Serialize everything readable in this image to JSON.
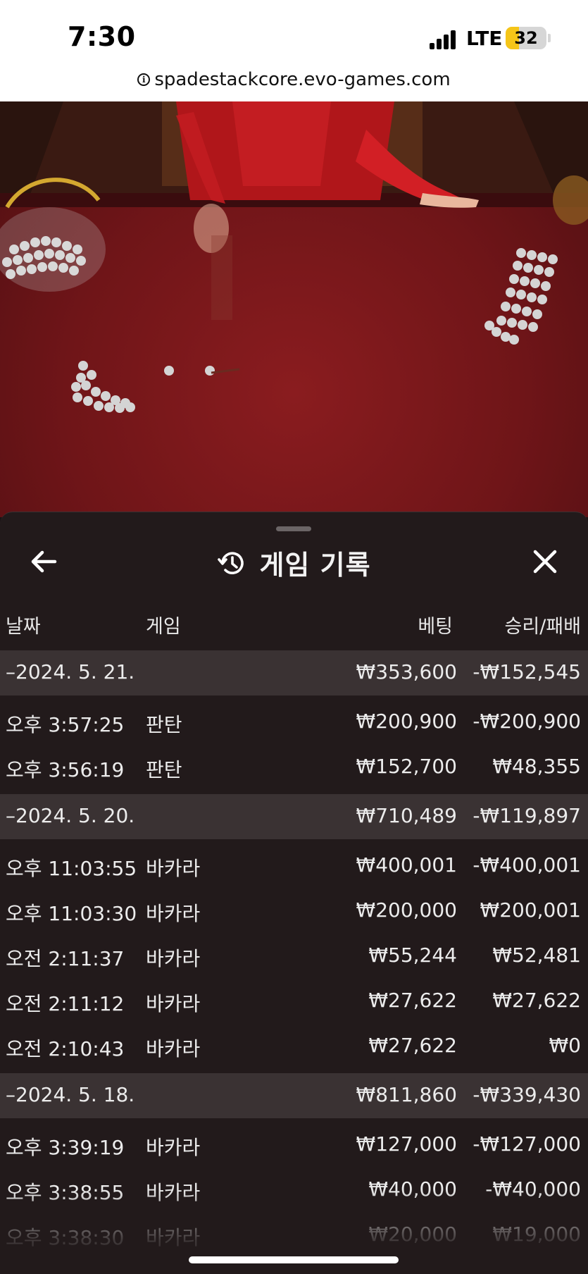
{
  "status_bar": {
    "time": "7:30",
    "network": "LTE",
    "battery": "32",
    "battery_level": 0.32
  },
  "url_bar": {
    "url": "spadestackcore.evo-games.com"
  },
  "panel": {
    "title": "게임 기록",
    "columns": {
      "date": "날짜",
      "game": "게임",
      "bet": "베팅",
      "result": "승리/패배"
    }
  },
  "history": [
    {
      "type": "date",
      "time": "–2024. 5. 21.",
      "game": "",
      "bet": "₩353,600",
      "result": "-₩152,545"
    },
    {
      "type": "row",
      "time": "오후 3:57:25",
      "game": "판탄",
      "bet": "₩200,900",
      "result": "-₩200,900"
    },
    {
      "type": "row",
      "time": "오후 3:56:19",
      "game": "판탄",
      "bet": "₩152,700",
      "result": "₩48,355"
    },
    {
      "type": "date",
      "time": "–2024. 5. 20.",
      "game": "",
      "bet": "₩710,489",
      "result": "-₩119,897"
    },
    {
      "type": "row",
      "time": "오후 11:03:55",
      "game": "바카라",
      "bet": "₩400,001",
      "result": "-₩400,001"
    },
    {
      "type": "row",
      "time": "오후 11:03:30",
      "game": "바카라",
      "bet": "₩200,000",
      "result": "₩200,001"
    },
    {
      "type": "row",
      "time": "오전 2:11:37",
      "game": "바카라",
      "bet": "₩55,244",
      "result": "₩52,481"
    },
    {
      "type": "row",
      "time": "오전 2:11:12",
      "game": "바카라",
      "bet": "₩27,622",
      "result": "₩27,622"
    },
    {
      "type": "row",
      "time": "오전 2:10:43",
      "game": "바카라",
      "bet": "₩27,622",
      "result": "₩0"
    },
    {
      "type": "date",
      "time": "–2024. 5. 18.",
      "game": "",
      "bet": "₩811,860",
      "result": "-₩339,430"
    },
    {
      "type": "row",
      "time": "오후 3:39:19",
      "game": "바카라",
      "bet": "₩127,000",
      "result": "-₩127,000"
    },
    {
      "type": "row",
      "time": "오후 3:38:55",
      "game": "바카라",
      "bet": "₩40,000",
      "result": "-₩40,000"
    },
    {
      "type": "row",
      "time": "오후 3:38:30",
      "game": "바카라",
      "bet": "₩20,000",
      "result": "₩19,000"
    }
  ],
  "icons": {
    "back": "arrow-left-icon",
    "history": "history-clock-icon",
    "close": "close-icon",
    "info": "info-icon"
  },
  "colors": {
    "panel_bg": "#221a1b",
    "date_row_bg": "#3a3233",
    "table_felt": "#7a181b"
  }
}
